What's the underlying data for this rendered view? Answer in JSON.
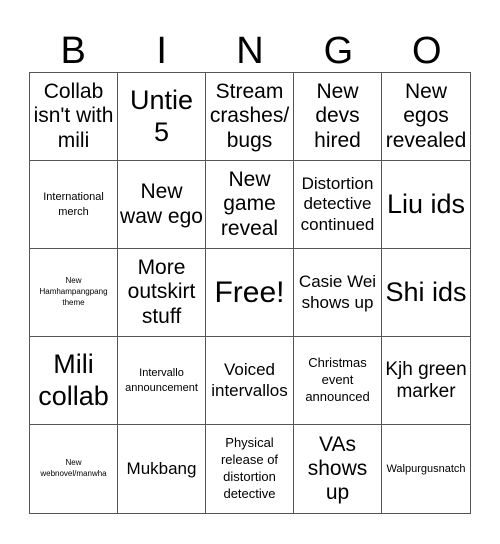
{
  "header": [
    "B",
    "I",
    "N",
    "G",
    "O"
  ],
  "cells": [
    "Collab isn't with mili",
    "Untie 5",
    "Stream crashes/ bugs",
    "New devs hired",
    "New egos revealed",
    "International merch",
    "New waw ego",
    "New game reveal",
    "Distortion detective continued",
    "Liu ids",
    "New Hamhampangpang theme",
    "More outskirt stuff",
    "Free!",
    "Casie Wei shows up",
    "Shi ids",
    "Mili collab",
    "Intervallo announcement",
    "Voiced intervallos",
    "Christmas event announced",
    "Kjh green marker",
    "New webnovel/manwha",
    "Mukbang",
    "Physical release of distortion detective",
    "VAs shows up",
    "Walpurgusnatch"
  ]
}
